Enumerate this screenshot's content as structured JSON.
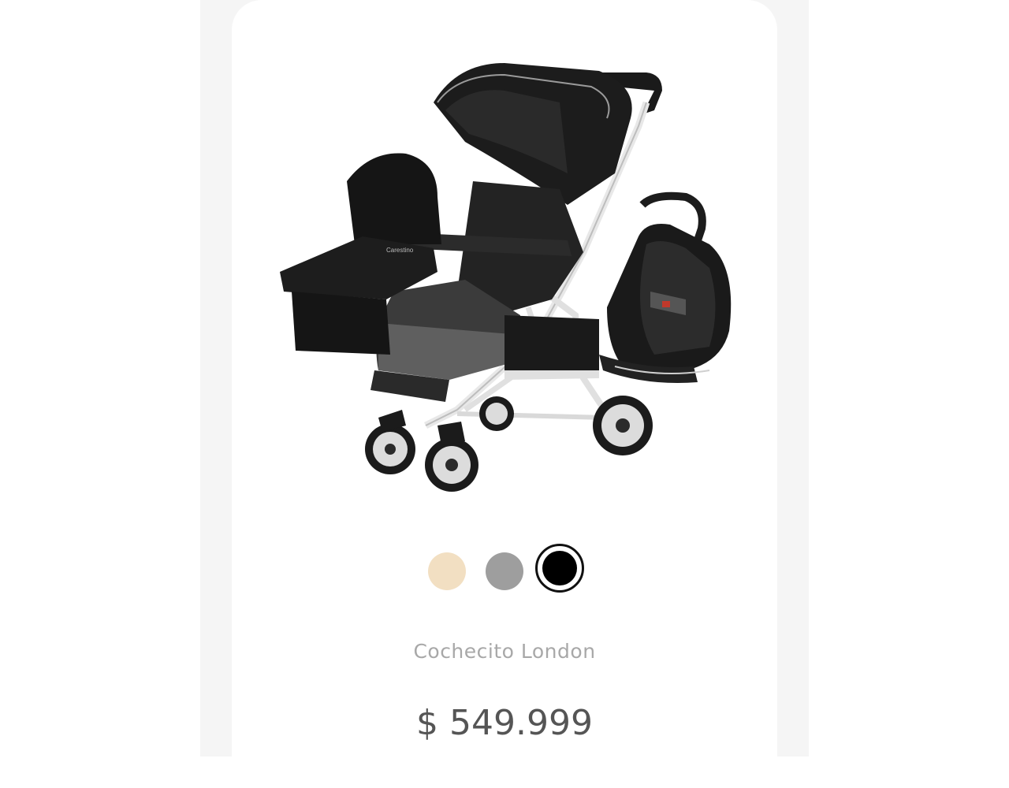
{
  "product": {
    "name": "Cochecito London",
    "price": "$ 549.999",
    "image_alt": "Cochecito London stroller with bassinet and car seat",
    "brand_on_product": "Carestino"
  },
  "color_options": [
    {
      "name": "beige",
      "hex": "#f2dfc2",
      "selected": false
    },
    {
      "name": "gray",
      "hex": "#9e9e9e",
      "selected": false
    },
    {
      "name": "black",
      "hex": "#000000",
      "selected": true
    }
  ]
}
